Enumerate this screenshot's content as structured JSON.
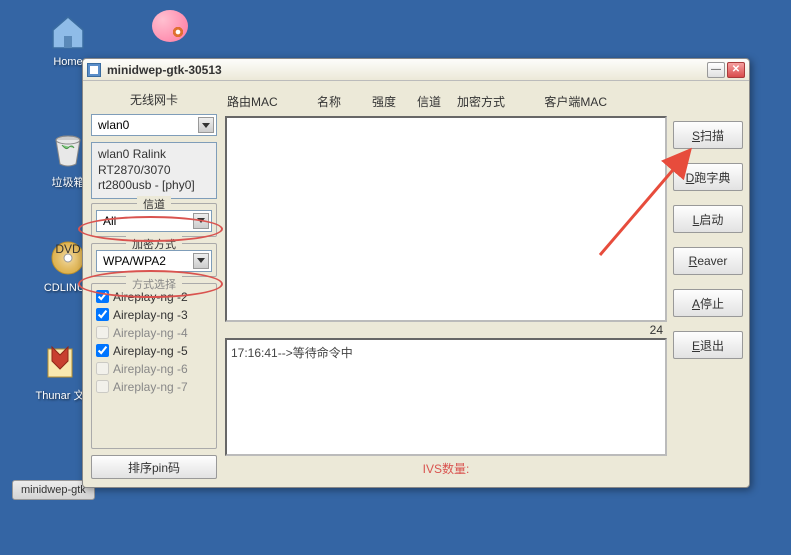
{
  "desktop": {
    "home_label": "Home",
    "trash_label": "垃圾箱",
    "cd_label": "CDLINUX",
    "thunar_label": "Thunar 文",
    "taskbar_label": "minidwep-gtk"
  },
  "window": {
    "title": "minidwep-gtk-30513"
  },
  "left": {
    "wireless_label": "无线网卡",
    "wlan_selected": "wlan0",
    "wlan_info_l1": "wlan0 Ralink",
    "wlan_info_l2": "RT2870/3070",
    "wlan_info_l3": "rt2800usb - [phy0]",
    "channel_label": "信道",
    "channel_selected": "All",
    "encryption_label": "加密方式",
    "encryption_selected": "WPA/WPA2",
    "mode_label": "方式选择",
    "modes": [
      {
        "label": "Aireplay-ng -2",
        "checked": true
      },
      {
        "label": "Aireplay-ng -3",
        "checked": true
      },
      {
        "label": "Aireplay-ng -4",
        "checked": false
      },
      {
        "label": "Aireplay-ng -5",
        "checked": true
      },
      {
        "label": "Aireplay-ng -6",
        "checked": false
      },
      {
        "label": "Aireplay-ng -7",
        "checked": false
      }
    ],
    "sort_pin_label": "排序pin码"
  },
  "columns": {
    "route_mac": "路由MAC",
    "name": "名称",
    "strength": "强度",
    "channel": "信道",
    "encryption": "加密方式",
    "client_mac": "客户端MAC"
  },
  "center": {
    "count": "24",
    "log_line": "17:16:41-->等待命令中",
    "ivs_label": "IVS数量:"
  },
  "buttons": {
    "scan": "S扫描",
    "dict": "D跑字典",
    "launch": "L启动",
    "reaver": "Reaver",
    "stop": "A停止",
    "exit": "E退出"
  }
}
